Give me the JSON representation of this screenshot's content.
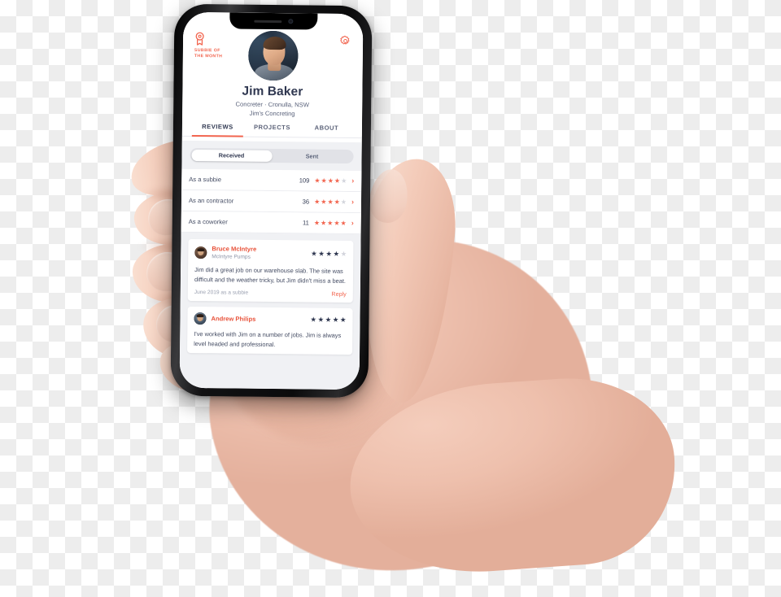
{
  "app": {
    "badge": {
      "icon": "award-ribbon-icon",
      "line1": "SUBBIE OF",
      "line2": "THE MONTH"
    },
    "settings_icon": "gear-icon",
    "avatar": "profile-photo",
    "profile": {
      "name": "Jim Baker",
      "trade_location": "Concreter · Cronulla, NSW",
      "business": "Jim's Concreting"
    },
    "tabs": [
      {
        "label": "REVIEWS",
        "active": true
      },
      {
        "label": "PROJECTS",
        "active": false
      },
      {
        "label": "ABOUT",
        "active": false
      }
    ],
    "segmented": [
      {
        "label": "Received",
        "active": true
      },
      {
        "label": "Sent",
        "active": false
      }
    ],
    "rating_rows": [
      {
        "label": "As a subbie",
        "count": "109",
        "stars": 4,
        "max": 5,
        "chevron": "chevron-right-icon"
      },
      {
        "label": "As an contractor",
        "count": "36",
        "stars": 4,
        "max": 5,
        "chevron": "chevron-right-icon"
      },
      {
        "label": "As a coworker",
        "count": "11",
        "stars": 5,
        "max": 5,
        "chevron": "chevron-right-icon"
      }
    ],
    "reviews": [
      {
        "name": "Bruce McIntyre",
        "company": "McIntyre Pumps",
        "stars": 4,
        "max": 5,
        "body": "Jim did a great job on our warehouse slab. The site was difficult and the weather tricky, but Jim didn't miss a beat.",
        "date": "June 2019 as a subbie",
        "reply": "Reply"
      },
      {
        "name": "Andrew Philips",
        "company": "",
        "stars": 5,
        "max": 5,
        "body": "I've worked with Jim on a number of jobs. Jim is always level headed and professional.",
        "date": "",
        "reply": ""
      }
    ]
  },
  "colors": {
    "accent": "#f2654f",
    "name_red": "#e8533b",
    "text_dark": "#2f3750",
    "text_body": "#444c63",
    "muted": "#8d94a6",
    "screen_bg": "#f0f1f4",
    "card_bg": "#ffffff",
    "checker": "#ededed"
  }
}
